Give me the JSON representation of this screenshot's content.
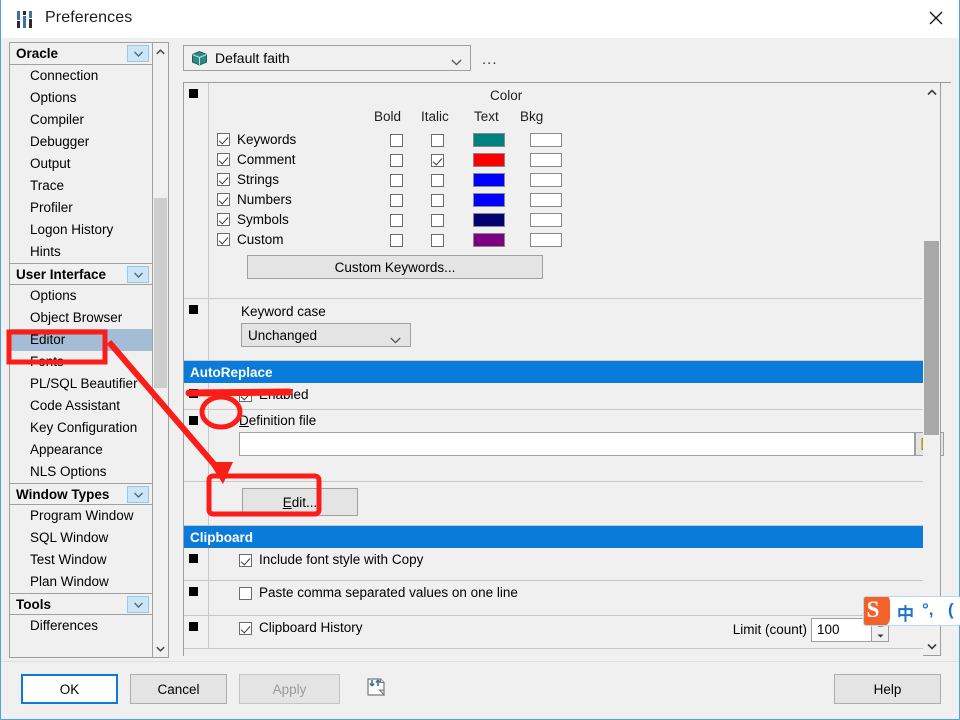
{
  "window": {
    "title": "Preferences",
    "title_icon": "sliders-icon",
    "close_icon": "close-icon"
  },
  "sidebar": {
    "groups": [
      {
        "label": "Oracle",
        "items": [
          "Connection",
          "Options",
          "Compiler",
          "Debugger",
          "Output",
          "Trace",
          "Profiler",
          "Logon History",
          "Hints"
        ]
      },
      {
        "label": "User Interface",
        "items": [
          "Options",
          "Object Browser",
          "Editor",
          "Fonts",
          "PL/SQL Beautifier",
          "Code Assistant",
          "Key Configuration",
          "Appearance",
          "NLS Options"
        ]
      },
      {
        "label": "Window Types",
        "items": [
          "Program Window",
          "SQL Window",
          "Test Window",
          "Plan Window"
        ]
      },
      {
        "label": "Tools",
        "items": [
          "Differences"
        ]
      }
    ],
    "selected": "Editor"
  },
  "topbar": {
    "scheme_value": "Default faith",
    "scheme_icon": "package-icon",
    "caret_icon": "chevron-down-icon",
    "more_label": "..."
  },
  "syntax": {
    "color_group_label": "Color",
    "columns": [
      "Bold",
      "Italic",
      "Text",
      "Bkg"
    ],
    "rows": [
      {
        "name": "Keywords",
        "enabled": true,
        "bold": false,
        "italic": false,
        "text_color": "#00807f",
        "bkg_color": "#ffffff"
      },
      {
        "name": "Comment",
        "enabled": true,
        "bold": false,
        "italic": true,
        "text_color": "#fb0000",
        "bkg_color": "#ffffff"
      },
      {
        "name": "Strings",
        "enabled": true,
        "bold": false,
        "italic": false,
        "text_color": "#0000fe",
        "bkg_color": "#ffffff"
      },
      {
        "name": "Numbers",
        "enabled": true,
        "bold": false,
        "italic": false,
        "text_color": "#0000fe",
        "bkg_color": "#ffffff"
      },
      {
        "name": "Symbols",
        "enabled": true,
        "bold": false,
        "italic": false,
        "text_color": "#000071",
        "bkg_color": "#ffffff"
      },
      {
        "name": "Custom",
        "enabled": true,
        "bold": false,
        "italic": false,
        "text_color": "#7b0082",
        "bkg_color": "#ffffff"
      }
    ],
    "custom_keywords_button": "Custom Keywords..."
  },
  "keyword_case": {
    "label": "Keyword case",
    "value": "Unchanged",
    "caret_icon": "chevron-down-icon"
  },
  "autoreplace": {
    "header": "AutoReplace",
    "enabled_label": "Enabled",
    "enabled_checked": true,
    "definition_file_label": "Definition file",
    "definition_file_value": "",
    "browse_icon": "folder-icon",
    "edit_button": "Edit..."
  },
  "clipboard": {
    "header": "Clipboard",
    "include_font_style_label": "Include font style with Copy",
    "include_font_style_checked": true,
    "paste_csv_label": "Paste comma separated values on one line",
    "paste_csv_checked": false,
    "history_label": "Clipboard History",
    "history_checked": true,
    "limit_label": "Limit (count)",
    "limit_value": "100"
  },
  "footer": {
    "ok": "OK",
    "cancel": "Cancel",
    "apply": "Apply",
    "help": "Help",
    "import_export_icon": "import-export-icon"
  },
  "ime": {
    "logo": "S",
    "mode": "中",
    "punct": "°,",
    "extra": "("
  },
  "theme": {
    "section_header_bg": "#0a7bd8",
    "selection_bg": "#a4bcd6",
    "annotation_red": "#fb1d17",
    "window_border": "#4ea3e0"
  }
}
